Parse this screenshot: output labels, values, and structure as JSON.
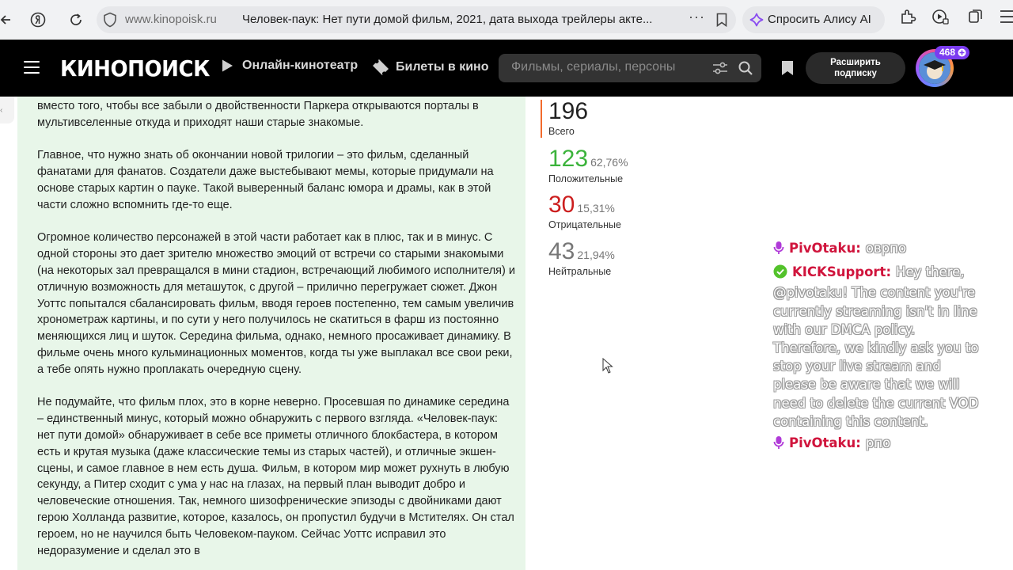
{
  "browser": {
    "domain": "www.kinopoisk.ru",
    "tab_title": "Человек-паук: Нет пути домой фильм, 2021, дата выхода трейлеры акте...",
    "more": "···",
    "alice_label": "Спросить Алису AI"
  },
  "header": {
    "logo": "КИНОПОИСК",
    "nav_online": "Онлайн-кинотеатр",
    "nav_tickets": "Билеты в кино",
    "search_placeholder": "Фильмы, сериалы, персоны",
    "subscribe_line1": "Расширить",
    "subscribe_line2": "подписку",
    "avatar_badge": "468"
  },
  "review": {
    "paragraphs": [
      "вместо того, чтобы все забыли о двойственности Паркера открываются порталы в мультивселенные откуда и приходят наши старые знакомые.",
      "Главное, что нужно знать об окончании новой трилогии – это фильм, сделанный фанатами для фанатов. Создатели даже выстебывают мемы, которые придумали на основе старых картин о пауке. Такой выверенный баланс юмора и драмы, как в этой части сложно вспомнить где-то еще.",
      "Огромное количество персонажей в этой части работает как в плюс, так и в минус. С одной стороны это дает зрителю множество эмоций от встречи со старыми знакомыми (на некоторых зал превращался в мини стадион, встречающий любимого исполнителя) и отличную возможность для меташуток, с другой – прилично перегружает сюжет. Джон Уоттс попытался сбалансировать фильм, вводя героев постепенно, тем самым увеличив хронометраж картины, и по сути у него получилось не скатиться в фарш из постоянно меняющихся лиц и шуток. Середина фильма, однако, немного просаживает динамику. В фильме очень много кульминационных моментов, когда ты уже выплакал все свои реки, а тебе опять нужно проплакать очередную сцену.",
      "Не подумайте, что фильм плох, это в корне неверно. Просевшая по динамике середина – единственный минус, который можно обнаружить с первого взгляда. «Человек-паук: нет пути домой» обнаруживает в себе все приметы отличного блокбастера, в котором есть и крутая музыка (даже классические темы из старых частей), и отличные экшен-сцены, и самое главное в нем есть душа. Фильм, в котором мир может рухнуть в любую секунду, а Питер сходит с ума у нас на глазах, на первый план выводит добро и человеческие отношения. Так, немного шизофренические эпизоды с двойниками дают герою Холланда развитие, которое, казалось, он пропустил будучи в Мстителях. Он стал героем, но не научился быть Человеком-пауком. Сейчас Уоттс исправил это недоразумение и сделал это в"
    ]
  },
  "stats": {
    "total": {
      "value": "196",
      "label": "Всего"
    },
    "positive": {
      "value": "123",
      "pct": "62,76%",
      "label": "Положительные"
    },
    "negative": {
      "value": "30",
      "pct": "15,31%",
      "label": "Отрицательные"
    },
    "neutral": {
      "value": "43",
      "pct": "21,94%",
      "label": "Нейтральные"
    },
    "colors": {
      "total_bar": "#f26b2c",
      "positive": "#3bb33b",
      "negative": "#cc1e1e",
      "neutral": "#777777"
    }
  },
  "chat": {
    "messages": [
      {
        "user": "PivOtaku",
        "icon": "microphone-icon",
        "text": "оврпо"
      },
      {
        "user": "KICKSupport",
        "icon": "verified-badge-icon",
        "text": "Hey there, @pivotaku! The content you're currently streaming isn't in line with our DMCA policy. Therefore, we kindly ask you to stop your live stream and please be aware that we will need to delete the current VOD containing this content."
      },
      {
        "user": "PivOtaku",
        "icon": "microphone-icon",
        "text": "рпо"
      }
    ]
  }
}
